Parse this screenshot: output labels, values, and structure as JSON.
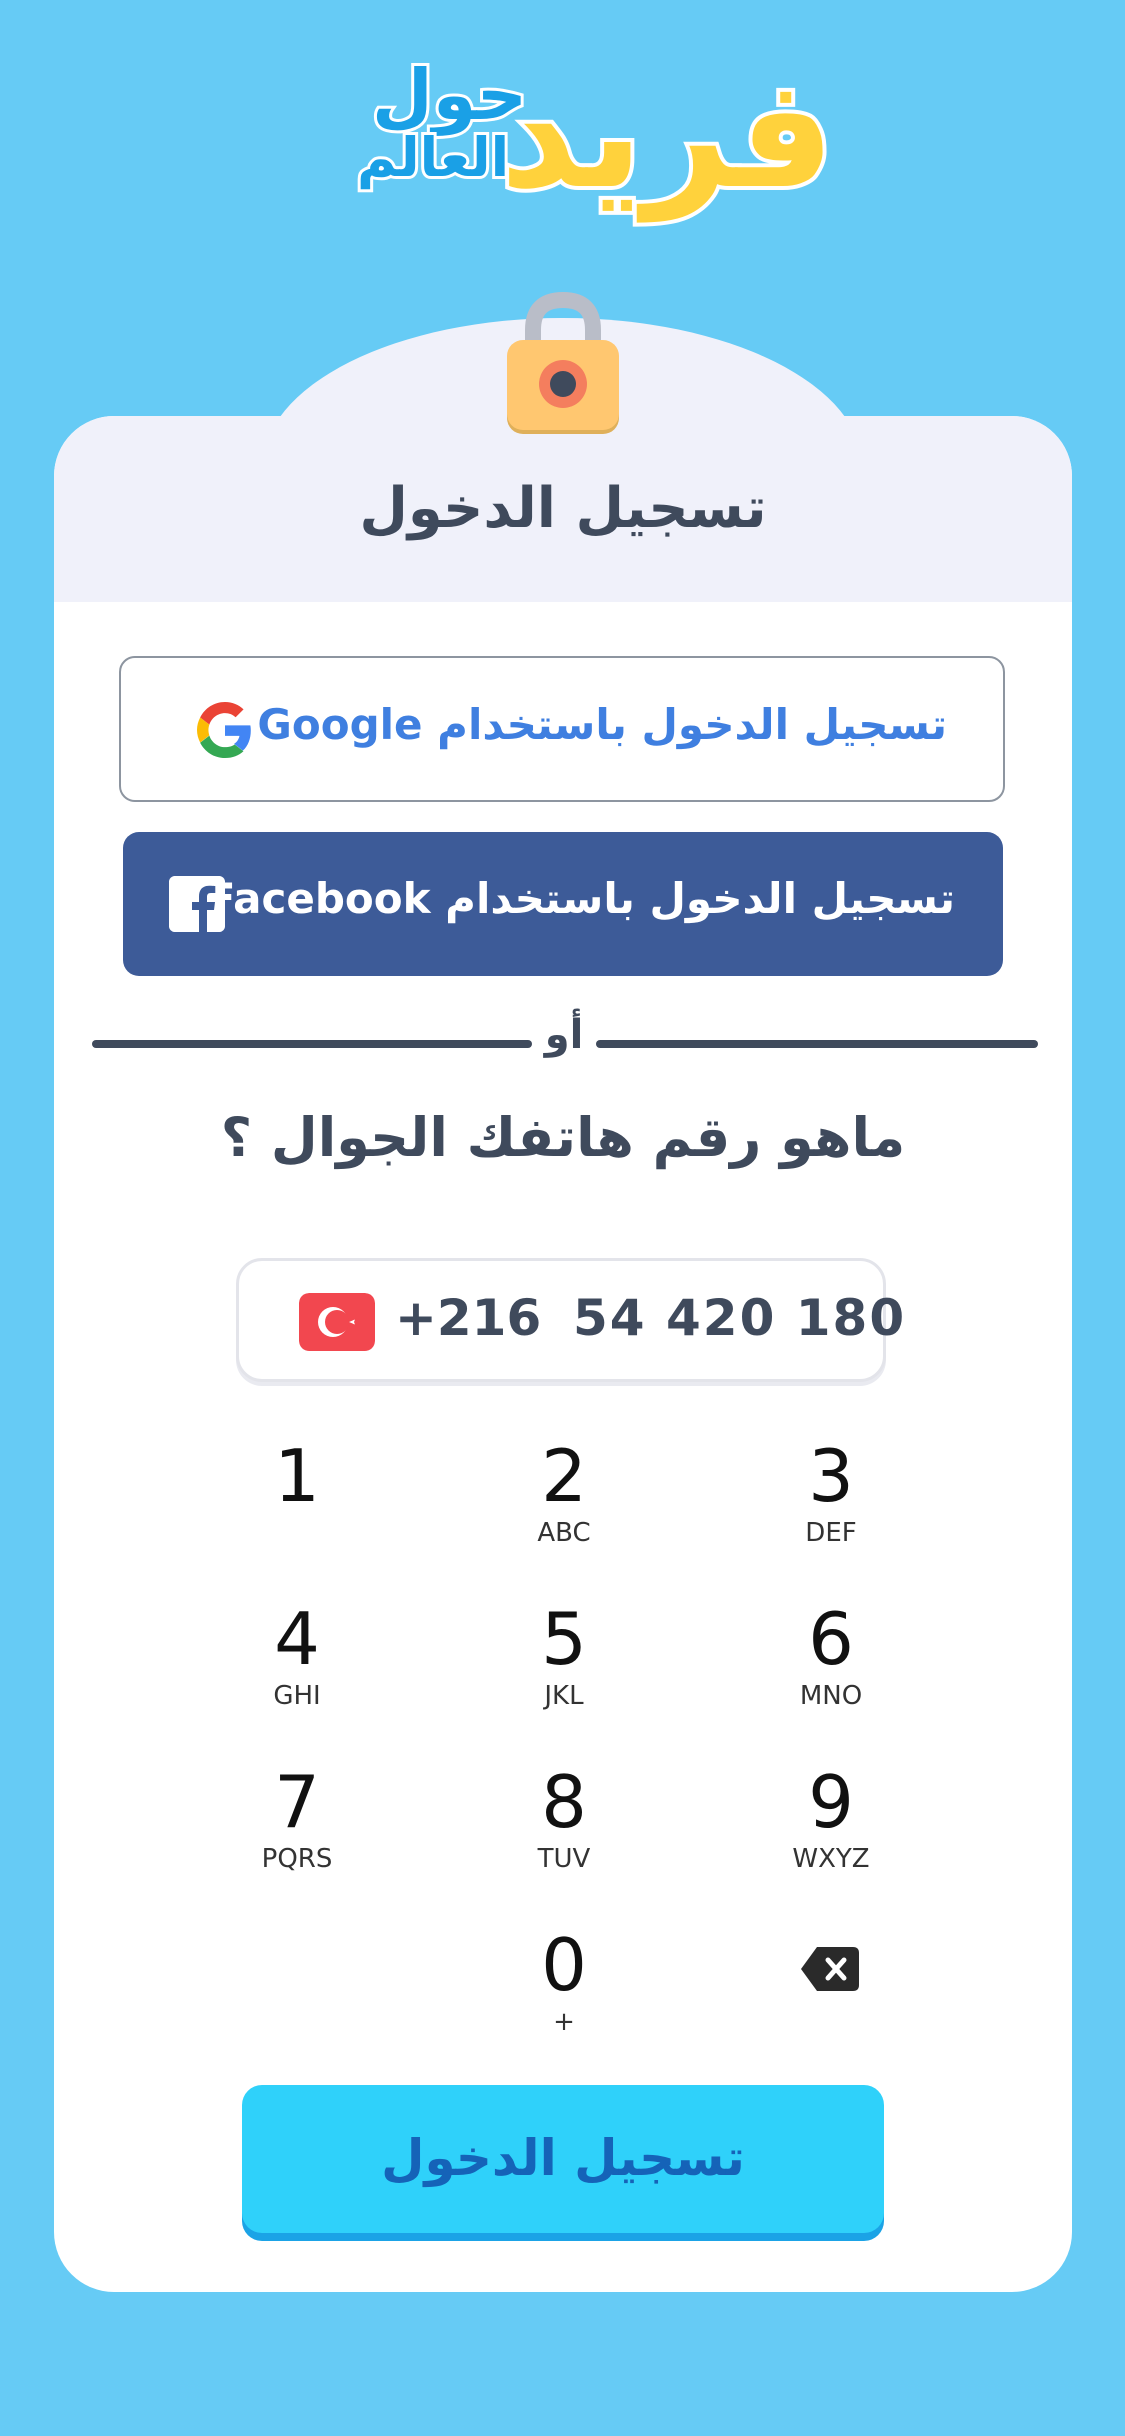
{
  "logo": {
    "main": "فريد",
    "line1": "حول",
    "line2": "العالم"
  },
  "title": "تسجيل الدخول",
  "google_button": {
    "label": "تسجيل الدخول باستخدام  Google",
    "icon": "google-icon"
  },
  "facebook_button": {
    "label": "تسجيل الدخول باستخدام  Facebook",
    "icon": "facebook-icon"
  },
  "divider": {
    "label": "أو"
  },
  "question": "ماهو رقم هاتفك الجوال ؟",
  "phone": {
    "flag": "turkey-flag-icon",
    "country_code": "+216",
    "number": "54 420 180"
  },
  "keypad": [
    {
      "digit": "1",
      "letters": ""
    },
    {
      "digit": "2",
      "letters": "ABC"
    },
    {
      "digit": "3",
      "letters": "DEF"
    },
    {
      "digit": "4",
      "letters": "GHI"
    },
    {
      "digit": "5",
      "letters": "JKL"
    },
    {
      "digit": "6",
      "letters": "MNO"
    },
    {
      "digit": "7",
      "letters": "PQRS"
    },
    {
      "digit": "8",
      "letters": "TUV"
    },
    {
      "digit": "9",
      "letters": "WXYZ"
    },
    {
      "digit": "0",
      "letters": "+"
    }
  ],
  "backspace_icon": "backspace-icon",
  "login_button": {
    "label": "تسجيل الدخول"
  },
  "colors": {
    "background": "#66CBF5",
    "facebook": "#3D5B98",
    "google_text": "#3F7FE0",
    "login_button": "#2FD1FA",
    "login_text": "#1563B8",
    "text_dark": "#3F4A5C"
  }
}
